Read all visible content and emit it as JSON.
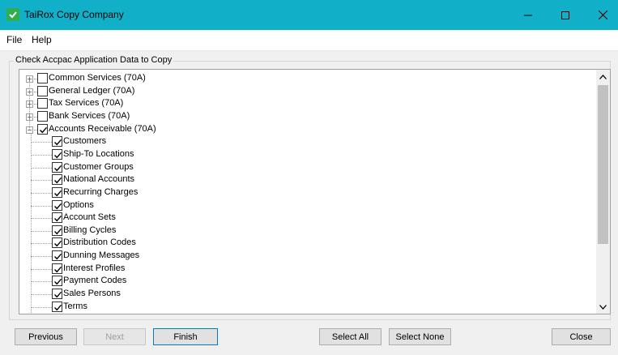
{
  "window": {
    "title": "TaiRox Copy Company",
    "controls": {
      "minimize": "—",
      "maximize": "☐",
      "close": "✕"
    }
  },
  "menu": {
    "file": "File",
    "help": "Help"
  },
  "group": {
    "legend": "Check Accpac Application Data to Copy"
  },
  "tree": {
    "modules": [
      {
        "label": "Common Services (70A)",
        "checked": false,
        "expanded": false,
        "expander": "+"
      },
      {
        "label": "General Ledger (70A)",
        "checked": false,
        "expanded": false,
        "expander": "+"
      },
      {
        "label": "Tax Services (70A)",
        "checked": false,
        "expanded": false,
        "expander": "+"
      },
      {
        "label": "Bank Services (70A)",
        "checked": false,
        "expanded": false,
        "expander": "+"
      },
      {
        "label": "Accounts Receivable (70A)",
        "checked": true,
        "expanded": true,
        "expander": "−"
      }
    ],
    "ar_children": [
      {
        "label": "Customers",
        "checked": true
      },
      {
        "label": "Ship-To Locations",
        "checked": true
      },
      {
        "label": "Customer Groups",
        "checked": true
      },
      {
        "label": "National Accounts",
        "checked": true
      },
      {
        "label": "Recurring Charges",
        "checked": true
      },
      {
        "label": "Options",
        "checked": true
      },
      {
        "label": "Account Sets",
        "checked": true
      },
      {
        "label": "Billing Cycles",
        "checked": true
      },
      {
        "label": "Distribution Codes",
        "checked": true
      },
      {
        "label": "Dunning Messages",
        "checked": true
      },
      {
        "label": "Interest Profiles",
        "checked": true
      },
      {
        "label": "Payment Codes",
        "checked": true
      },
      {
        "label": "Sales Persons",
        "checked": true
      },
      {
        "label": "Terms",
        "checked": true
      }
    ]
  },
  "scrollbar": {
    "up_icon": "chevron-up",
    "down_icon": "chevron-down",
    "thumb_fraction": 0.74
  },
  "buttons": {
    "previous": "Previous",
    "next": "Next",
    "finish": "Finish",
    "select_all": "Select All",
    "select_none": "Select None",
    "close": "Close"
  },
  "colors": {
    "titlebar": "#12b0c8",
    "app_icon": "#2fae4e",
    "focus_border": "#0078d7"
  }
}
